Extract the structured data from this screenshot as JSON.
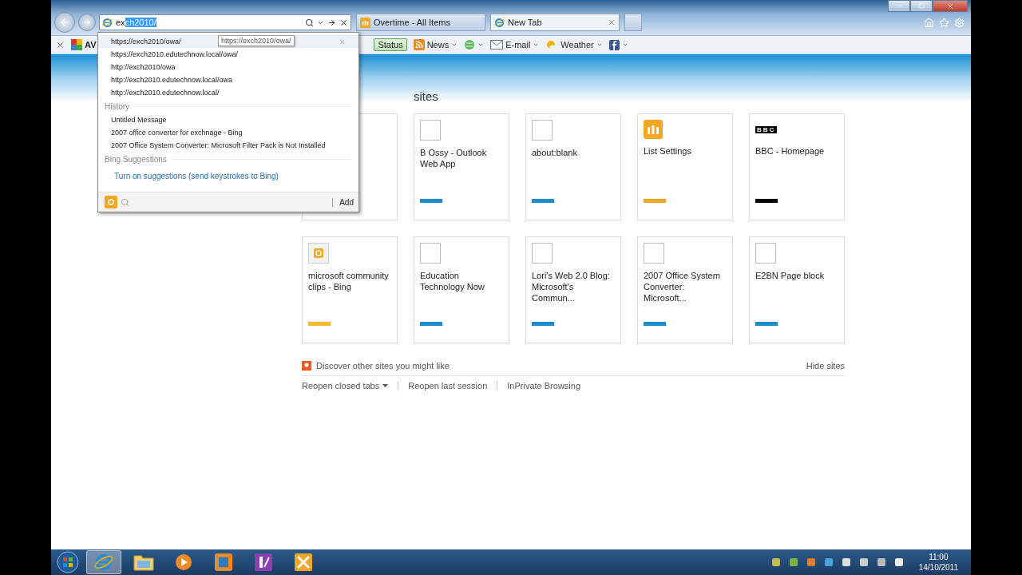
{
  "address_bar": {
    "typed": "ex",
    "completion": "ch2010/"
  },
  "tabs": [
    {
      "title": "Overtime - All Items",
      "kind": "list",
      "selected": false
    },
    {
      "title": "New Tab",
      "kind": "ie",
      "selected": true
    }
  ],
  "toolbar": [
    {
      "kind": "avg",
      "label": "AV"
    },
    {
      "kind": "status",
      "label": "Status"
    },
    {
      "kind": "rss",
      "label": "News"
    },
    {
      "kind": "web"
    },
    {
      "kind": "email",
      "label": "E-mail"
    },
    {
      "kind": "weather",
      "label": "Weather"
    },
    {
      "kind": "facebook"
    }
  ],
  "autocomplete": {
    "urls": [
      {
        "text": "https://exch2010/owa/",
        "selected": true
      },
      {
        "text": "https://exch2010.edutechnow.local/owa/",
        "selected": false
      },
      {
        "text": "http://exch2010/owa",
        "selected": false
      },
      {
        "text": "http://exch2010.edutechnow.local/owa",
        "selected": false
      },
      {
        "text": "http://exch2010.edutechnow.local/",
        "selected": false
      }
    ],
    "tooltip": "https://exch2010/owa/",
    "history_heading": "History",
    "history": [
      "Untitled Message",
      "2007 office converter for exchnage - Bing",
      "2007 Office System Converter: Microsoft Filter Pack is Not Installed"
    ],
    "bing_heading": "Bing Suggestions",
    "bing_link": "Turn on suggestions (send keystrokes to Bing)",
    "add_button": "Add"
  },
  "page": {
    "heading": "sites",
    "tiles": [
      {
        "title": "B Ossy - Outlook Web App",
        "kind": "blank",
        "color": "#1b8ccc"
      },
      {
        "title": "about:blank",
        "kind": "blank",
        "color": "#1b8ccc"
      },
      {
        "title": "List Settings",
        "kind": "list",
        "color": "#f5a623"
      },
      {
        "title": "BBC - Homepage",
        "kind": "bbc",
        "logo": "BBC",
        "color": "#000000"
      },
      {
        "title": "microsoft community clips - Bing",
        "kind": "bing",
        "color": "#f5b82e"
      },
      {
        "title": "Education Technology Now",
        "kind": "blank",
        "color": "#1b8ccc"
      },
      {
        "title": "Lori's Web 2.0 Blog: Microsoft's Commun...",
        "kind": "blank",
        "color": "#1b8ccc"
      },
      {
        "title": "2007 Office System Converter: Microsoft...",
        "kind": "blank",
        "color": "#1b8ccc"
      },
      {
        "title": "E2BN Page block",
        "kind": "blank",
        "color": "#1b8ccc"
      }
    ],
    "discover": "Discover other sites you might like",
    "hide": "Hide sites",
    "links": [
      {
        "label": "Reopen closed tabs",
        "menu": true
      },
      {
        "label": "Reopen last session",
        "menu": false
      },
      {
        "label": "InPrivate Browsing",
        "menu": false
      }
    ]
  },
  "taskbar": {
    "apps": [
      {
        "kind": "ie",
        "active": true
      },
      {
        "kind": "explorer",
        "active": false
      },
      {
        "kind": "media",
        "active": false
      },
      {
        "kind": "orange",
        "active": false
      },
      {
        "kind": "onenote",
        "active": false
      },
      {
        "kind": "tools",
        "active": false
      }
    ],
    "time": "11:00",
    "date": "14/10/2011"
  }
}
